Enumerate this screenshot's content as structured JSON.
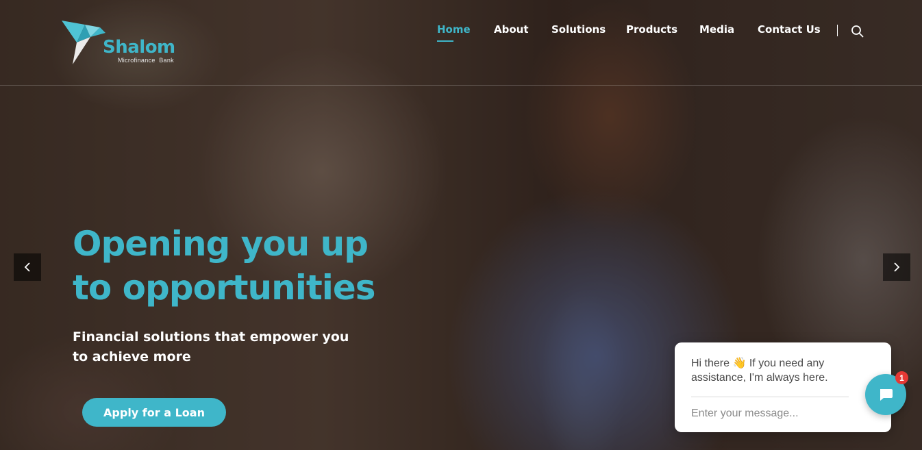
{
  "brand": {
    "name": "Shalom",
    "tagline": "Microfinance  Bank",
    "accent_color": "#3fb6c9"
  },
  "nav": {
    "items": [
      {
        "label": "Home",
        "active": true
      },
      {
        "label": "About",
        "active": false
      },
      {
        "label": "Solutions",
        "active": false
      },
      {
        "label": "Products",
        "active": false
      },
      {
        "label": "Media",
        "active": false
      },
      {
        "label": "Contact Us",
        "active": false
      }
    ],
    "search_icon": "search-icon"
  },
  "hero": {
    "headline_line1": "Opening you up",
    "headline_line2": "to opportunities",
    "subheadline_line1": "Financial solutions that empower you",
    "subheadline_line2": "to achieve more",
    "cta_label": "Apply for a Loan",
    "prev_icon": "chevron-left-icon",
    "next_icon": "chevron-right-icon"
  },
  "chat": {
    "greeting_before": "Hi there",
    "greeting_emoji": "👋",
    "greeting_after": " If you need any assistance, I'm always here.",
    "input_placeholder": "Enter your message...",
    "unread_count": "1",
    "launcher_icon": "chat-bubble-icon"
  }
}
